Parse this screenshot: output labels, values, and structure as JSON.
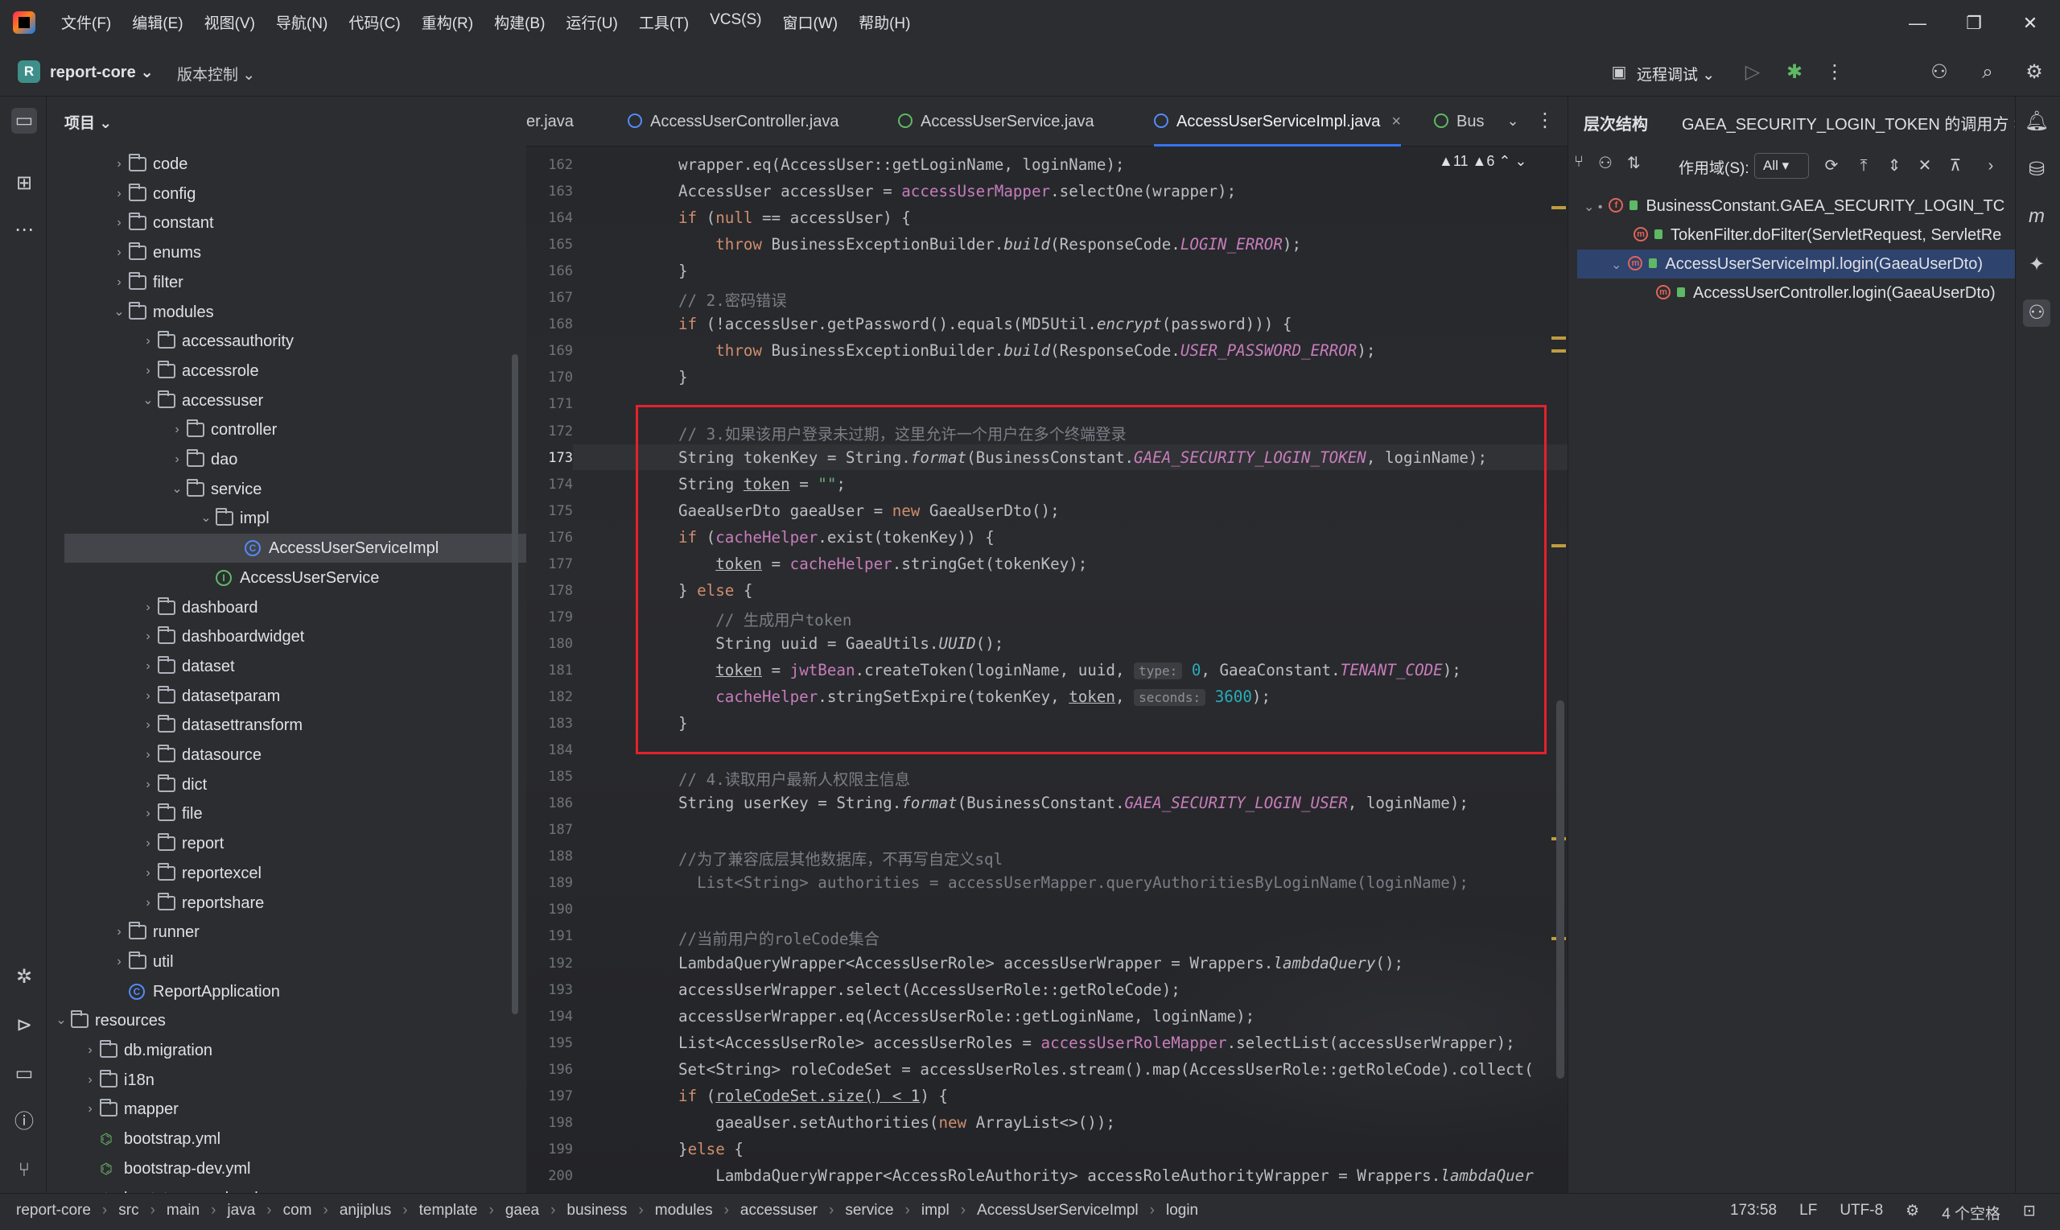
{
  "menu": [
    "文件(F)",
    "编辑(E)",
    "视图(V)",
    "导航(N)",
    "代码(C)",
    "重构(R)",
    "构建(B)",
    "运行(U)",
    "工具(T)",
    "VCS(S)",
    "窗口(W)",
    "帮助(H)"
  ],
  "window": {
    "minimize": "—",
    "restore": "❐",
    "close": "✕"
  },
  "toolbar": {
    "project_initial": "R",
    "project_name": "report-core ⌄",
    "vcs": "版本控制 ⌄",
    "remote_debug": "远程调试 ⌄"
  },
  "project_panel": {
    "header": "项目 ⌄",
    "tree": [
      {
        "label": "code",
        "depth": 0,
        "type": "folder",
        "arrow": "›"
      },
      {
        "label": "config",
        "depth": 0,
        "type": "folder",
        "arrow": "›"
      },
      {
        "label": "constant",
        "depth": 0,
        "type": "folder",
        "arrow": "›"
      },
      {
        "label": "enums",
        "depth": 0,
        "type": "folder",
        "arrow": "›"
      },
      {
        "label": "filter",
        "depth": 0,
        "type": "folder",
        "arrow": "›"
      },
      {
        "label": "modules",
        "depth": 0,
        "type": "folder",
        "arrow": "⌄"
      },
      {
        "label": "accessauthority",
        "depth": 1,
        "type": "folder",
        "arrow": "›"
      },
      {
        "label": "accessrole",
        "depth": 1,
        "type": "folder",
        "arrow": "›"
      },
      {
        "label": "accessuser",
        "depth": 1,
        "type": "folder",
        "arrow": "⌄"
      },
      {
        "label": "controller",
        "depth": 2,
        "type": "folder",
        "arrow": "›"
      },
      {
        "label": "dao",
        "depth": 2,
        "type": "folder",
        "arrow": "›"
      },
      {
        "label": "service",
        "depth": 2,
        "type": "folder",
        "arrow": "⌄"
      },
      {
        "label": "impl",
        "depth": 3,
        "type": "folder",
        "arrow": "⌄"
      },
      {
        "label": "AccessUserServiceImpl",
        "depth": 4,
        "type": "class",
        "arrow": "",
        "selected": true
      },
      {
        "label": "AccessUserService",
        "depth": 3,
        "type": "interface",
        "arrow": ""
      },
      {
        "label": "dashboard",
        "depth": 1,
        "type": "folder",
        "arrow": "›"
      },
      {
        "label": "dashboardwidget",
        "depth": 1,
        "type": "folder",
        "arrow": "›"
      },
      {
        "label": "dataset",
        "depth": 1,
        "type": "folder",
        "arrow": "›"
      },
      {
        "label": "datasetparam",
        "depth": 1,
        "type": "folder",
        "arrow": "›"
      },
      {
        "label": "datasettransform",
        "depth": 1,
        "type": "folder",
        "arrow": "›"
      },
      {
        "label": "datasource",
        "depth": 1,
        "type": "folder",
        "arrow": "›"
      },
      {
        "label": "dict",
        "depth": 1,
        "type": "folder",
        "arrow": "›"
      },
      {
        "label": "file",
        "depth": 1,
        "type": "folder",
        "arrow": "›"
      },
      {
        "label": "report",
        "depth": 1,
        "type": "folder",
        "arrow": "›"
      },
      {
        "label": "reportexcel",
        "depth": 1,
        "type": "folder",
        "arrow": "›"
      },
      {
        "label": "reportshare",
        "depth": 1,
        "type": "folder",
        "arrow": "›"
      },
      {
        "label": "runner",
        "depth": 0,
        "type": "folder",
        "arrow": "›"
      },
      {
        "label": "util",
        "depth": 0,
        "type": "folder",
        "arrow": "›"
      },
      {
        "label": "ReportApplication",
        "depth": 0,
        "type": "class",
        "arrow": ""
      },
      {
        "label": "resources",
        "depth": -2,
        "type": "folder",
        "arrow": "⌄"
      },
      {
        "label": "db.migration",
        "depth": -1,
        "type": "folder",
        "arrow": "›"
      },
      {
        "label": "i18n",
        "depth": -1,
        "type": "folder",
        "arrow": "›"
      },
      {
        "label": "mapper",
        "depth": -1,
        "type": "folder",
        "arrow": "›"
      },
      {
        "label": "bootstrap.yml",
        "depth": -1,
        "type": "yml",
        "arrow": ""
      },
      {
        "label": "bootstrap-dev.yml",
        "depth": -1,
        "type": "yml",
        "arrow": ""
      },
      {
        "label": "bootstrap-prod.yml",
        "depth": -1,
        "type": "yml",
        "arrow": ""
      }
    ]
  },
  "editor_tabs": [
    {
      "label": "er.java",
      "icon": "none"
    },
    {
      "label": "AccessUserController.java",
      "icon": "class"
    },
    {
      "label": "AccessUserService.java",
      "icon": "interface"
    },
    {
      "label": "AccessUserServiceImpl.java",
      "icon": "class",
      "active": true,
      "close": "×"
    },
    {
      "label": "Bus",
      "icon": "interface"
    }
  ],
  "editor": {
    "warnings": "▲11 ▲6 ⌃ ⌄",
    "current_line": "173",
    "lines": [
      {
        "n": "162",
        "html": "wrapper.eq(AccessUser::getLoginName, loginName);"
      },
      {
        "n": "163",
        "html": "AccessUser accessUser = <span class='fld'>accessUserMapper</span>.selectOne(wrapper);"
      },
      {
        "n": "164",
        "html": "<span class='kw'>if</span> (<span class='kw'>null</span> == accessUser) {"
      },
      {
        "n": "165",
        "html": "    <span class='kw'>throw</span> BusinessExceptionBuilder.<span class='mth'>build</span>(ResponseCode.<span class='st'>LOGIN_ERROR</span>);"
      },
      {
        "n": "166",
        "html": "}"
      },
      {
        "n": "167",
        "html": "<span class='cmt'>// 2.密码错误</span>"
      },
      {
        "n": "168",
        "html": "<span class='kw'>if</span> (!accessUser.getPassword().equals(MD5Util.<span class='mth'>encrypt</span>(password))) {"
      },
      {
        "n": "169",
        "html": "    <span class='kw'>throw</span> BusinessExceptionBuilder.<span class='mth'>build</span>(ResponseCode.<span class='st'>USER_PASSWORD_ERROR</span>);"
      },
      {
        "n": "170",
        "html": "}"
      },
      {
        "n": "171",
        "html": ""
      },
      {
        "n": "172",
        "html": "<span class='cmt'>// 3.如果该用户登录未过期，这里允许一个用户在多个终端登录</span>"
      },
      {
        "n": "173",
        "html": "String tokenKey = String.<span class='mth'>format</span>(BusinessConstant.<span class='st'>GAEA_SECURITY_LOGIN_TOKEN</span>, loginName);"
      },
      {
        "n": "174",
        "html": "String <span class='ul'>token</span> = <span class='str'>\"\"</span>;"
      },
      {
        "n": "175",
        "html": "GaeaUserDto gaeaUser = <span class='kw'>new</span> GaeaUserDto();"
      },
      {
        "n": "176",
        "html": "<span class='kw'>if</span> (<span class='fld'>cacheHelper</span>.exist(tokenKey)) {"
      },
      {
        "n": "177",
        "html": "    <span class='ul'>token</span> = <span class='fld'>cacheHelper</span>.stringGet(tokenKey);"
      },
      {
        "n": "178",
        "html": "} <span class='kw'>else</span> {"
      },
      {
        "n": "179",
        "html": "    <span class='cmt'>// 生成用户token</span>"
      },
      {
        "n": "180",
        "html": "    String uuid = GaeaUtils.<span class='mth'>UUID</span>();"
      },
      {
        "n": "181",
        "html": "    <span class='ul'>token</span> = <span class='fld'>jwtBean</span>.createToken(loginName, uuid, <span class='hint'>type:</span> <span class='num'>0</span>, GaeaConstant.<span class='st'>TENANT_CODE</span>);"
      },
      {
        "n": "182",
        "html": "    <span class='fld'>cacheHelper</span>.stringSetExpire(tokenKey, <span class='ul'>token</span>, <span class='hint'>seconds:</span> <span class='num'>3600</span>);"
      },
      {
        "n": "183",
        "html": "}"
      },
      {
        "n": "184",
        "html": ""
      },
      {
        "n": "185",
        "html": "<span class='cmt'>// 4.读取用户最新人权限主信息</span>"
      },
      {
        "n": "186",
        "html": "String userKey = String.<span class='mth'>format</span>(BusinessConstant.<span class='st'>GAEA_SECURITY_LOGIN_USER</span>, loginName);"
      },
      {
        "n": "187",
        "html": ""
      },
      {
        "n": "188",
        "html": "<span class='cmt'>//为了兼容底层其他数据库，不再写自定义sql</span>"
      },
      {
        "n": "189",
        "html": "<span class='cmt'>  List&lt;String&gt; authorities = accessUserMapper.queryAuthoritiesByLoginName(loginName);</span>"
      },
      {
        "n": "190",
        "html": ""
      },
      {
        "n": "191",
        "html": "<span class='cmt'>//当前用户的roleCode集合</span>"
      },
      {
        "n": "192",
        "html": "LambdaQueryWrapper&lt;AccessUserRole&gt; accessUserWrapper = Wrappers.<span class='mth'>lambdaQuery</span>();"
      },
      {
        "n": "193",
        "html": "accessUserWrapper.select(AccessUserRole::getRoleCode);"
      },
      {
        "n": "194",
        "html": "accessUserWrapper.eq(AccessUserRole::getLoginName, loginName);"
      },
      {
        "n": "195",
        "html": "List&lt;AccessUserRole&gt; accessUserRoles = <span class='fld'>accessUserRoleMapper</span>.selectList(accessUserWrapper);"
      },
      {
        "n": "196",
        "html": "Set&lt;String&gt; roleCodeSet = accessUserRoles.stream().map(AccessUserRole::getRoleCode).collect("
      },
      {
        "n": "197",
        "html": "<span class='kw'>if</span> (<span class='ul'>roleCodeSet.size() &lt; 1</span>) {"
      },
      {
        "n": "198",
        "html": "    gaeaUser.setAuthorities(<span class='kw'>new</span> ArrayList&lt;&gt;());"
      },
      {
        "n": "199",
        "html": "}<span class='kw'>else</span> {"
      },
      {
        "n": "200",
        "html": "    LambdaQueryWrapper&lt;AccessRoleAuthority&gt; accessRoleAuthorityWrapper = Wrappers.<span class='mth'>lambdaQuer</span>"
      }
    ]
  },
  "right_panel": {
    "title": "层次结构",
    "tab": "GAEA_SECURITY_LOGIN_TOKEN 的调用方 ×",
    "scope_label": "作用域(S):",
    "scope_value": "All ▾",
    "rows": [
      {
        "label": "BusinessConstant.GAEA_SECURITY_LOGIN_TC",
        "indent": 0,
        "icon": "f",
        "arrow": "⌄ •"
      },
      {
        "label": "TokenFilter.doFilter(ServletRequest, ServletRe",
        "indent": 1,
        "icon": "m",
        "arrow": ""
      },
      {
        "label": "AccessUserServiceImpl.login(GaeaUserDto)",
        "indent": 1,
        "icon": "m",
        "arrow": "⌄",
        "selected": true
      },
      {
        "label": "AccessUserController.login(GaeaUserDto)",
        "indent": 2,
        "icon": "m",
        "arrow": ""
      }
    ]
  },
  "statusbar": {
    "breadcrumb": [
      "report-core",
      "src",
      "main",
      "java",
      "com",
      "anjiplus",
      "template",
      "gaea",
      "business",
      "modules",
      "accessuser",
      "service",
      "impl",
      "AccessUserServiceImpl",
      "login"
    ],
    "position": "173:58",
    "line_sep": "LF",
    "encoding": "UTF-8",
    "indent": "4 个空格"
  }
}
